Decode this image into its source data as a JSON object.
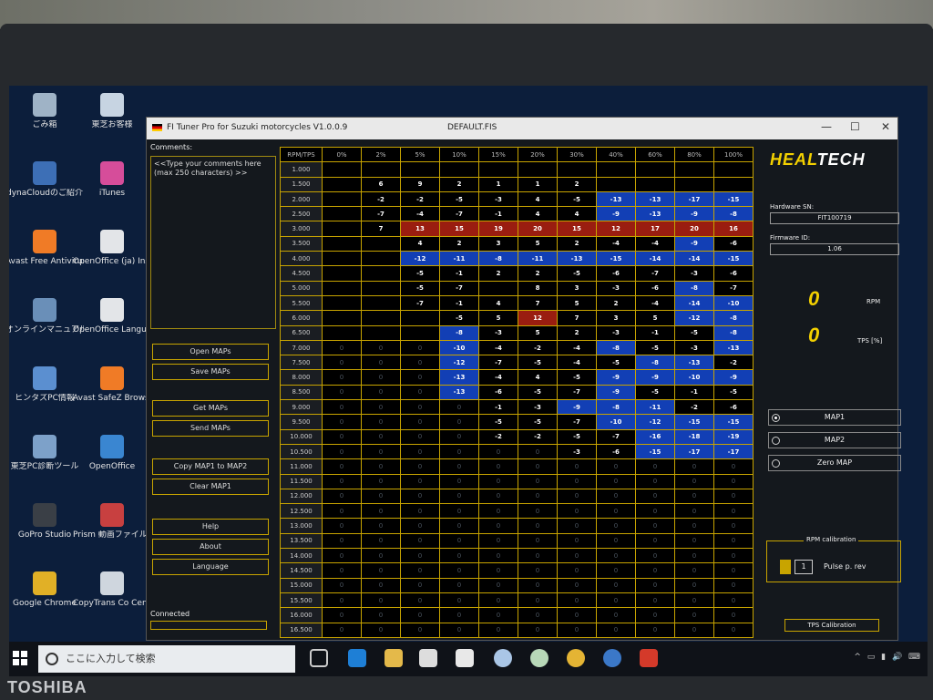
{
  "window": {
    "app_title": "FI Tuner Pro for Suzuki motorcycles V1.0.0.9",
    "file_title": "DEFAULT.FIS"
  },
  "desktop_icons": [
    {
      "label": "ごみ箱",
      "color": "#9fb3c6"
    },
    {
      "label": "dynaCloudのご紹介",
      "color": "#3d6fb6"
    },
    {
      "label": "Avast Free Antivirus",
      "color": "#f07b26"
    },
    {
      "label": "オンラインマニュアル",
      "color": "#6a8fb8"
    },
    {
      "label": "ヒンタズPC情報",
      "color": "#5b8fd0"
    },
    {
      "label": "東芝PC診断ツール",
      "color": "#7da1c9"
    },
    {
      "label": "GoPro Studio",
      "color": "#3a3f46"
    },
    {
      "label": "Google Chrome",
      "color": "#e1b026"
    },
    {
      "label": "東芝お客様",
      "color": "#c7d4e2"
    },
    {
      "label": "iTunes",
      "color": "#d64d9a"
    },
    {
      "label": "OpenOffice (ja) Installati",
      "color": "#e3e5e8"
    },
    {
      "label": "OpenOffice Language P",
      "color": "#e3e5e8"
    },
    {
      "label": "Avast SafeZ Browser",
      "color": "#f07b26"
    },
    {
      "label": "OpenOffice",
      "color": "#3a86d1"
    },
    {
      "label": "Prism 動画ファイル 変換ソフト",
      "color": "#c84040"
    },
    {
      "label": "CopyTrans Co Center",
      "color": "#cfd6de"
    }
  ],
  "left_panel": {
    "comments_label": "Comments:",
    "comments_placeholder": "<<Type your comments here (max 250 characters) >>",
    "buttons": [
      "Open MAPs",
      "Save MAPs",
      "Get MAPs",
      "Send MAPs",
      "Copy MAP1 to MAP2",
      "Clear MAP1",
      "Help",
      "About",
      "Language"
    ],
    "status": "Connected"
  },
  "map": {
    "header_label": "RPM/TPS",
    "tps_columns": [
      "0%",
      "2%",
      "5%",
      "10%",
      "15%",
      "20%",
      "30%",
      "40%",
      "60%",
      "80%",
      "100%"
    ],
    "rows": [
      {
        "rpm": "1.000",
        "cells": [
          "",
          "",
          "",
          "",
          "",
          "",
          "",
          "",
          "",
          "",
          ""
        ]
      },
      {
        "rpm": "1.500",
        "cells": [
          "",
          "6",
          "9",
          "2",
          "1",
          "1",
          "2",
          "",
          "",
          "",
          ""
        ]
      },
      {
        "rpm": "2.000",
        "cells": [
          "",
          "-2",
          "-2",
          "-5",
          "-3",
          "4",
          "-5",
          "-13",
          "-13",
          "-17",
          "-15"
        ]
      },
      {
        "rpm": "2.500",
        "cells": [
          "",
          "-7",
          "-4",
          "-7",
          "-1",
          "4",
          "4",
          "-9",
          "-13",
          "-9",
          "-8"
        ]
      },
      {
        "rpm": "3.000",
        "cells": [
          "",
          "7",
          "13",
          "15",
          "19",
          "20",
          "15",
          "12",
          "17",
          "20",
          "16"
        ]
      },
      {
        "rpm": "3.500",
        "cells": [
          "",
          "",
          "4",
          "2",
          "3",
          "5",
          "2",
          "-4",
          "-4",
          "-9",
          "-6"
        ]
      },
      {
        "rpm": "4.000",
        "cells": [
          "",
          "",
          "-12",
          "-11",
          "-8",
          "-11",
          "-13",
          "-15",
          "-14",
          "-14",
          "-15"
        ]
      },
      {
        "rpm": "4.500",
        "cells": [
          "",
          "",
          "-5",
          "-1",
          "2",
          "2",
          "-5",
          "-6",
          "-7",
          "-3",
          "-6"
        ]
      },
      {
        "rpm": "5.000",
        "cells": [
          "",
          "",
          "-5",
          "-7",
          "",
          "8",
          "3",
          "-3",
          "-6",
          "-8",
          "-7"
        ]
      },
      {
        "rpm": "5.500",
        "cells": [
          "",
          "",
          "-7",
          "-1",
          "4",
          "7",
          "5",
          "2",
          "-4",
          "-14",
          "-10"
        ]
      },
      {
        "rpm": "6.000",
        "cells": [
          "",
          "",
          "",
          "-5",
          "5",
          "12",
          "7",
          "3",
          "5",
          "-12",
          "-8"
        ]
      },
      {
        "rpm": "6.500",
        "cells": [
          "",
          "",
          "",
          "-8",
          "-3",
          "5",
          "2",
          "-3",
          "-1",
          "-5",
          "-8"
        ]
      },
      {
        "rpm": "7.000",
        "cells": [
          "0",
          "0",
          "0",
          "-10",
          "-4",
          "-2",
          "-4",
          "-8",
          "-5",
          "-3",
          "-13"
        ]
      },
      {
        "rpm": "7.500",
        "cells": [
          "0",
          "0",
          "0",
          "-12",
          "-7",
          "-5",
          "-4",
          "-5",
          "-8",
          "-13",
          "-2"
        ]
      },
      {
        "rpm": "8.000",
        "cells": [
          "0",
          "0",
          "0",
          "-13",
          "-4",
          "4",
          "-5",
          "-9",
          "-9",
          "-10",
          "-9"
        ]
      },
      {
        "rpm": "8.500",
        "cells": [
          "0",
          "0",
          "0",
          "-13",
          "-6",
          "-5",
          "-7",
          "-9",
          "-5",
          "-1",
          "-5"
        ]
      },
      {
        "rpm": "9.000",
        "cells": [
          "0",
          "0",
          "0",
          "0",
          "-1",
          "-3",
          "-9",
          "-8",
          "-11",
          "-2",
          "-6"
        ]
      },
      {
        "rpm": "9.500",
        "cells": [
          "0",
          "0",
          "0",
          "0",
          "-5",
          "-5",
          "-7",
          "-10",
          "-12",
          "-15",
          "-15"
        ]
      },
      {
        "rpm": "10.000",
        "cells": [
          "0",
          "0",
          "0",
          "0",
          "-2",
          "-2",
          "-5",
          "-7",
          "-16",
          "-18",
          "-19"
        ]
      },
      {
        "rpm": "10.500",
        "cells": [
          "0",
          "0",
          "0",
          "0",
          "0",
          "0",
          "-3",
          "-6",
          "-15",
          "-17",
          "-17"
        ]
      },
      {
        "rpm": "11.000",
        "cells": [
          "0",
          "0",
          "0",
          "0",
          "0",
          "0",
          "0",
          "0",
          "0",
          "0",
          "0"
        ]
      },
      {
        "rpm": "11.500",
        "cells": [
          "0",
          "0",
          "0",
          "0",
          "0",
          "0",
          "0",
          "0",
          "0",
          "0",
          "0"
        ]
      },
      {
        "rpm": "12.000",
        "cells": [
          "0",
          "0",
          "0",
          "0",
          "0",
          "0",
          "0",
          "0",
          "0",
          "0",
          "0"
        ]
      },
      {
        "rpm": "12.500",
        "cells": [
          "0",
          "0",
          "0",
          "0",
          "0",
          "0",
          "0",
          "0",
          "0",
          "0",
          "0"
        ]
      },
      {
        "rpm": "13.000",
        "cells": [
          "0",
          "0",
          "0",
          "0",
          "0",
          "0",
          "0",
          "0",
          "0",
          "0",
          "0"
        ]
      },
      {
        "rpm": "13.500",
        "cells": [
          "0",
          "0",
          "0",
          "0",
          "0",
          "0",
          "0",
          "0",
          "0",
          "0",
          "0"
        ]
      },
      {
        "rpm": "14.000",
        "cells": [
          "0",
          "0",
          "0",
          "0",
          "0",
          "0",
          "0",
          "0",
          "0",
          "0",
          "0"
        ]
      },
      {
        "rpm": "14.500",
        "cells": [
          "0",
          "0",
          "0",
          "0",
          "0",
          "0",
          "0",
          "0",
          "0",
          "0",
          "0"
        ]
      },
      {
        "rpm": "15.000",
        "cells": [
          "0",
          "0",
          "0",
          "0",
          "0",
          "0",
          "0",
          "0",
          "0",
          "0",
          "0"
        ]
      },
      {
        "rpm": "15.500",
        "cells": [
          "0",
          "0",
          "0",
          "0",
          "0",
          "0",
          "0",
          "0",
          "0",
          "0",
          "0"
        ]
      },
      {
        "rpm": "16.000",
        "cells": [
          "0",
          "0",
          "0",
          "0",
          "0",
          "0",
          "0",
          "0",
          "0",
          "0",
          "0"
        ]
      },
      {
        "rpm": "16.500",
        "cells": [
          "0",
          "0",
          "0",
          "0",
          "0",
          "0",
          "0",
          "0",
          "0",
          "0",
          "0"
        ]
      }
    ]
  },
  "right_panel": {
    "logo_heal": "HEAL",
    "logo_tech": "TECH",
    "hardware_sn_label": "Hardware SN:",
    "hardware_sn": "FIT100719",
    "firmware_label": "Firmware ID:",
    "firmware_id": "1.06",
    "rpm_value": "0",
    "rpm_unit": "RPM",
    "tps_value": "0",
    "tps_unit": "TPS [%]",
    "map_options": [
      "MAP1",
      "MAP2",
      "Zero MAP"
    ],
    "selected_map": "MAP1",
    "rpm_cal_label": "RPM calibration",
    "pulse_value": "1",
    "pulse_label": "Pulse p. rev",
    "tps_cal_button": "TPS Calibration"
  },
  "taskbar": {
    "search_placeholder": "ここに入力して検索"
  },
  "laptop_brand": "TOSHIBA",
  "colors": {
    "grid_line": "#c8a400",
    "negative_cell": "#123fb5",
    "positive_cell": "#9a1d10",
    "logo_yellow": "#f3d000"
  }
}
